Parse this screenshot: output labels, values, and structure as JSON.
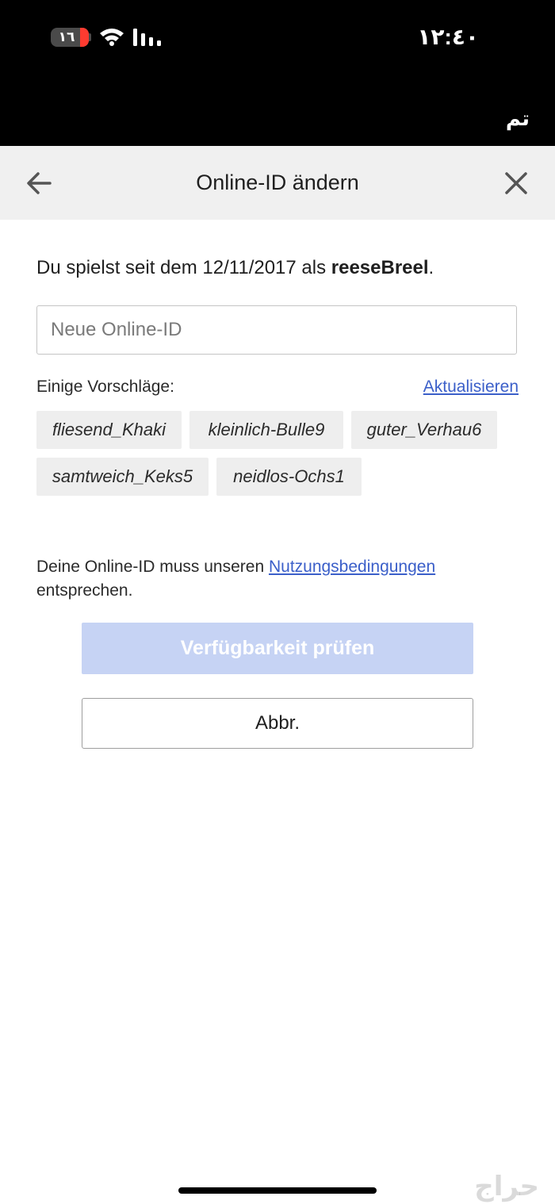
{
  "status_bar": {
    "battery_level": "١٦",
    "time": "١٢:٤٠",
    "done_label": "تم"
  },
  "header": {
    "title": "Online-ID ändern"
  },
  "intro": {
    "prefix": "Du spielst seit dem 12/11/2017 als ",
    "username": "reeseBreel",
    "suffix": "."
  },
  "online_id_input": {
    "value": "",
    "placeholder": "Neue Online-ID"
  },
  "suggestions": {
    "label": "Einige Vorschläge:",
    "refresh_label": "Aktualisieren",
    "items": [
      "fliesend_Khaki",
      "kleinlich-Bulle9",
      "guter_Verhau6",
      "samtweich_Keks5",
      "neidlos-Ochs1"
    ]
  },
  "terms": {
    "prefix": "Deine Online-ID muss unseren ",
    "link": "Nutzungsbedingungen",
    "suffix": " entsprechen."
  },
  "buttons": {
    "check_label": "Verfügbarkeit prüfen",
    "cancel_label": "Abbr."
  },
  "watermark": "حراج",
  "colors": {
    "accent": "#3b5fc9",
    "disabled_button": "#c6d3f4",
    "header_bg": "#f0f0f0",
    "chip_bg": "#eeeeee"
  }
}
